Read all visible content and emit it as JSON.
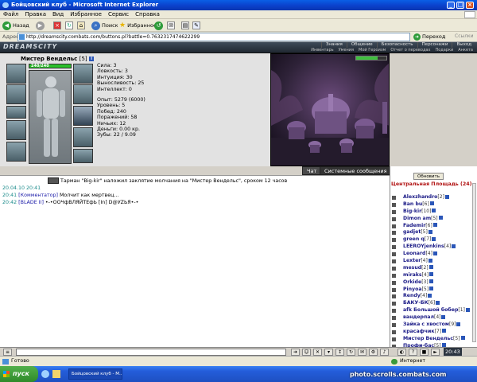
{
  "window": {
    "title": "Бойцовский клуб - Microsoft Internet Explorer"
  },
  "menu": [
    "Файл",
    "Правка",
    "Вид",
    "Избранное",
    "Сервис",
    "Справка"
  ],
  "toolbar": {
    "back": "Назад",
    "search": "Поиск",
    "favorites": "Избранное"
  },
  "address": {
    "label": "Адрес:",
    "url": "http://dreamscity.combats.com/buttons.pl?battle=0.7632317474622299",
    "go": "Переход",
    "links": "Ссылки"
  },
  "game": {
    "logo": "DREAMSCITY",
    "nav_top": [
      "Знания",
      "Общение",
      "Безопасность",
      "Персонажи",
      "Выход"
    ],
    "nav_bottom": [
      "Инвентарь",
      "Умения",
      "Мой Героизм",
      "Отчет о переводах",
      "Подарки",
      "Анкета"
    ]
  },
  "character": {
    "name": "Мистер Вендельс",
    "level": "[5]",
    "hp": "240/240",
    "hp_fraction": 1.0,
    "stats": [
      "Сила: 3",
      "Ловкость: 3",
      "Интуиция: 30",
      "Выносливость: 25",
      "Интеллект: 0"
    ],
    "exp": "Опыт: 5279 (6000)",
    "details": [
      "Уровень: 5",
      "Побед: 240",
      "Поражений: 58",
      "Ничьих: 12",
      "Деньги: 0.00 кр.",
      "Зубы: 22 / 9.09"
    ]
  },
  "chat": {
    "tab_chat": "Чат",
    "tab_system": "Системные сообщения",
    "lines": [
      {
        "time": "",
        "from": "",
        "text": "Тарман \"Big-kir\" наложил заклятие молчания на \"Мистер Вендельс\", сроком 12 часов"
      },
      {
        "time": "20.04.10 20:41",
        "from": "",
        "text": ""
      },
      {
        "time": "20:41",
        "from": "[Комментатор]",
        "text": " Молчит как мертвец..."
      },
      {
        "time": "20:42",
        "from": "[BLADE II]",
        "text": " •-•ООЧфВЛЯЙТЕфЬ [In] D@УZЬЯ•-•"
      }
    ]
  },
  "users": {
    "refresh": "Обновить",
    "location": "Центральная Площадь (24)",
    "list": [
      {
        "name": "Alexzhandro",
        "level": "[2]"
      },
      {
        "name": "Ban bu",
        "level": "[6]"
      },
      {
        "name": "Big-kir",
        "level": "[10]"
      },
      {
        "name": "Dimon am",
        "level": "[5]"
      },
      {
        "name": "Fademir",
        "level": "[6]"
      },
      {
        "name": "gadjet",
        "level": "[5]"
      },
      {
        "name": "green q",
        "level": "[7]"
      },
      {
        "name": "LEEROYjenkins",
        "level": "[4]"
      },
      {
        "name": "Leonard",
        "level": "[4]"
      },
      {
        "name": "Lexter",
        "level": "[4]"
      },
      {
        "name": "mesud",
        "level": "[2]"
      },
      {
        "name": "miraks",
        "level": "[4]"
      },
      {
        "name": "Orkide",
        "level": "[3]"
      },
      {
        "name": "Pinyoa",
        "level": "[5]"
      },
      {
        "name": "Rendy",
        "level": "[4]"
      },
      {
        "name": "БАКУ-БК",
        "level": "[6]"
      },
      {
        "name": "afk Большой бобер",
        "level": "[1]"
      },
      {
        "name": "вандерпал",
        "level": "[4]"
      },
      {
        "name": "Зайка с хвостом",
        "level": "[9]"
      },
      {
        "name": "красафчик",
        "level": "[7]"
      },
      {
        "name": "Мистер Вендельс",
        "level": "[5]"
      },
      {
        "name": "Профи-бас",
        "level": "[5]"
      }
    ]
  },
  "clock": "20:43",
  "status": {
    "done": "Готово",
    "zone": "Интернет"
  },
  "taskbar": {
    "start": "пуск",
    "task": "Бойцовский клуб - M..."
  },
  "watermark": "photo.scrolls.combats.com",
  "colors": {
    "title_blue": "#0b3fc9",
    "location_red": "#b01010",
    "nick_blue": "#1a1a86"
  }
}
